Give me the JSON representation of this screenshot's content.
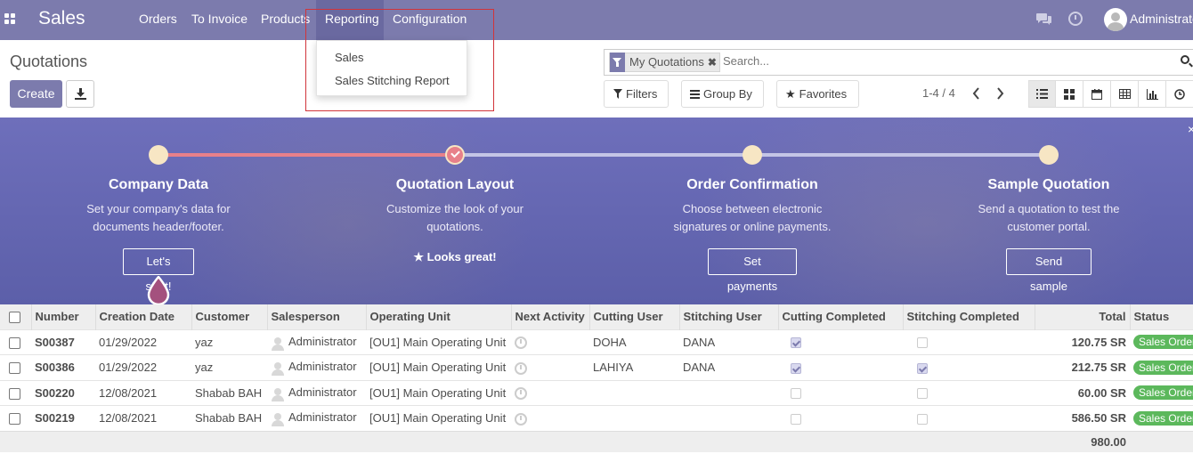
{
  "navbar": {
    "brand": "Sales",
    "menu": [
      "Orders",
      "To Invoice",
      "Products",
      "Reporting",
      "Configuration"
    ],
    "active_menu": "Reporting",
    "user": "Administrator",
    "bg_color": "#7c7bad"
  },
  "reporting_dropdown": {
    "items": [
      "Sales",
      "Sales Stitching Report"
    ]
  },
  "control_panel": {
    "title": "Quotations",
    "create_label": "Create",
    "facet_label": "My Quotations",
    "facet_close": "✖",
    "search_placeholder": "Search...",
    "filters_label": "Filters",
    "group_by_label": "Group By",
    "favorites_label": "Favorites",
    "pager": "1-4 / 4",
    "views": [
      "list-view-icon",
      "kanban-view-icon",
      "calendar-view-icon",
      "pivot-view-icon",
      "graph-view-icon",
      "activity-view-icon"
    ]
  },
  "onboarding": {
    "steps": [
      {
        "title": "Company Data",
        "desc1": "Set your company's data for",
        "desc2": "documents header/footer.",
        "action": "Let's start!",
        "done": false
      },
      {
        "title": "Quotation Layout",
        "desc1": "Customize the look of your",
        "desc2": "quotations.",
        "action": "Looks great!",
        "done": true
      },
      {
        "title": "Order Confirmation",
        "desc1": "Choose between electronic",
        "desc2": "signatures or online payments.",
        "action": "Set payments",
        "done": false
      },
      {
        "title": "Sample Quotation",
        "desc1": "Send a quotation to test the",
        "desc2": "customer portal.",
        "action": "Send sample",
        "done": false
      }
    ]
  },
  "table": {
    "headers": [
      "Number",
      "Creation Date",
      "Customer",
      "Salesperson",
      "Operating Unit",
      "Next Activity",
      "Cutting User",
      "Stitching User",
      "Cutting Completed",
      "Stitching Completed",
      "Total",
      "Status"
    ],
    "rows": [
      {
        "number": "S00387",
        "date": "01/29/2022",
        "customer": "yaz",
        "salesperson": "Administrator",
        "unit": "[OU1] Main Operating Unit",
        "cutting_user": "DOHA",
        "stitching_user": "DANA",
        "cutting_done": true,
        "stitching_done": false,
        "total": "120.75 SR",
        "status": "Sales Order"
      },
      {
        "number": "S00386",
        "date": "01/29/2022",
        "customer": "yaz",
        "salesperson": "Administrator",
        "unit": "[OU1] Main Operating Unit",
        "cutting_user": "LAHIYA",
        "stitching_user": "DANA",
        "cutting_done": true,
        "stitching_done": true,
        "total": "212.75 SR",
        "status": "Sales Order"
      },
      {
        "number": "S00220",
        "date": "12/08/2021",
        "customer": "Shabab BAH",
        "salesperson": "Administrator",
        "unit": "[OU1] Main Operating Unit",
        "cutting_user": "",
        "stitching_user": "",
        "cutting_done": false,
        "stitching_done": false,
        "total": "60.00 SR",
        "status": "Sales Order"
      },
      {
        "number": "S00219",
        "date": "12/08/2021",
        "customer": "Shabab BAH",
        "salesperson": "Administrator",
        "unit": "[OU1] Main Operating Unit",
        "cutting_user": "",
        "stitching_user": "",
        "cutting_done": false,
        "stitching_done": false,
        "total": "586.50 SR",
        "status": "Sales Order"
      }
    ],
    "grand_total": "980.00"
  }
}
